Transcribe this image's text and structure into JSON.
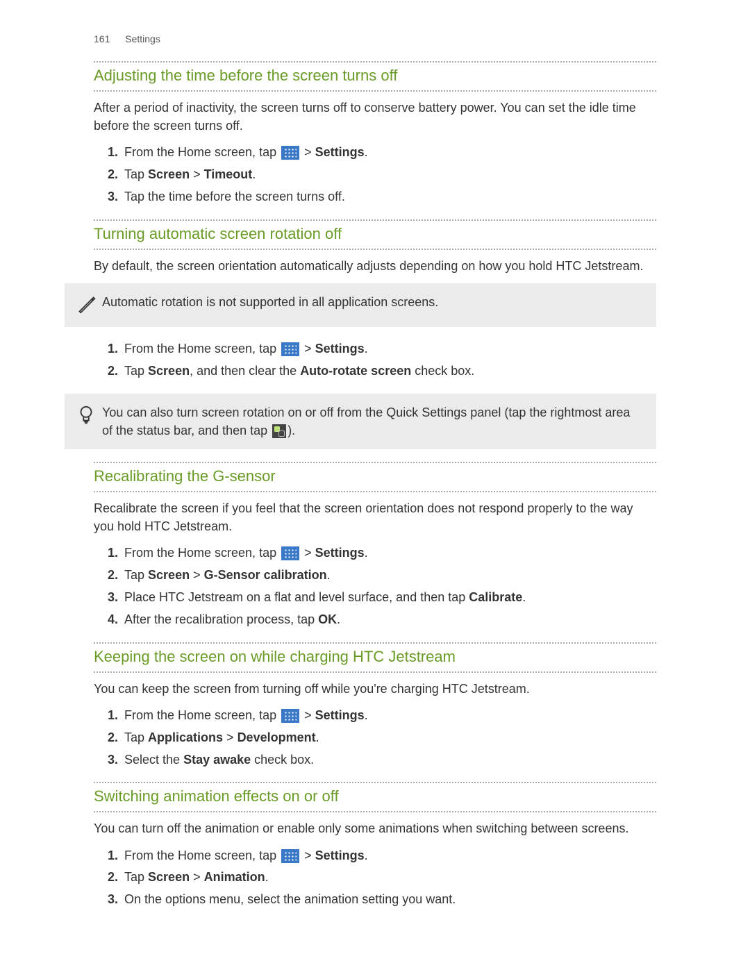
{
  "header": {
    "page_number": "161",
    "section_name": "Settings"
  },
  "icons": {
    "apps_grid": "apps-grid-icon",
    "quick_settings": "quick-settings-icon",
    "pencil": "pencil-icon",
    "lightbulb": "lightbulb-icon"
  },
  "sections": [
    {
      "title": "Adjusting the time before the screen turns off",
      "intro": "After a period of inactivity, the screen turns off to conserve battery power. You can set the idle time before the screen turns off.",
      "steps": [
        {
          "pre": "From the Home screen, tap ",
          "has_apps_icon": true,
          "mid": " > ",
          "bold1": "Settings",
          "post": "."
        },
        {
          "pre": "Tap ",
          "bold1": "Screen",
          "mid": " > ",
          "bold2": "Timeout",
          "post": "."
        },
        {
          "pre": "Tap the time before the screen turns off."
        }
      ]
    },
    {
      "title": "Turning automatic screen rotation off",
      "intro": "By default, the screen orientation automatically adjusts depending on how you hold HTC Jetstream.",
      "callout_note": "Automatic rotation is not supported in all application screens.",
      "steps": [
        {
          "pre": "From the Home screen, tap ",
          "has_apps_icon": true,
          "mid": " > ",
          "bold1": "Settings",
          "post": "."
        },
        {
          "pre": "Tap ",
          "bold1": "Screen",
          "mid": ", and then clear the ",
          "bold2": "Auto-rotate screen",
          "post": " check box."
        }
      ],
      "callout_tip_pre": "You can also turn screen rotation on or off from the Quick Settings panel (tap the rightmost area of the status bar, and then tap ",
      "callout_tip_post": ")."
    },
    {
      "title": "Recalibrating the G-sensor",
      "intro": "Recalibrate the screen if you feel that the screen orientation does not respond properly to the way you hold HTC Jetstream.",
      "steps": [
        {
          "pre": "From the Home screen, tap ",
          "has_apps_icon": true,
          "mid": " > ",
          "bold1": "Settings",
          "post": "."
        },
        {
          "pre": "Tap ",
          "bold1": "Screen",
          "mid": " > ",
          "bold2": "G-Sensor calibration",
          "post": "."
        },
        {
          "pre": "Place HTC Jetstream on a flat and level surface, and then tap ",
          "bold1": "Calibrate",
          "post": "."
        },
        {
          "pre": "After the recalibration process, tap ",
          "bold1": "OK",
          "post": "."
        }
      ]
    },
    {
      "title": "Keeping the screen on while charging HTC Jetstream",
      "intro": "You can keep the screen from turning off while you're charging HTC Jetstream.",
      "steps": [
        {
          "pre": "From the Home screen, tap ",
          "has_apps_icon": true,
          "mid": " > ",
          "bold1": "Settings",
          "post": "."
        },
        {
          "pre": "Tap ",
          "bold1": "Applications",
          "mid": " > ",
          "bold2": "Development",
          "post": "."
        },
        {
          "pre": "Select the ",
          "bold1": "Stay awake",
          "post": " check box."
        }
      ]
    },
    {
      "title": "Switching animation effects on or off",
      "intro": "You can turn off the animation or enable only some animations when switching between screens.",
      "steps": [
        {
          "pre": "From the Home screen, tap ",
          "has_apps_icon": true,
          "mid": " > ",
          "bold1": "Settings",
          "post": "."
        },
        {
          "pre": "Tap ",
          "bold1": "Screen",
          "mid": " > ",
          "bold2": "Animation",
          "post": "."
        },
        {
          "pre": "On the options menu, select the animation setting you want."
        }
      ]
    }
  ]
}
